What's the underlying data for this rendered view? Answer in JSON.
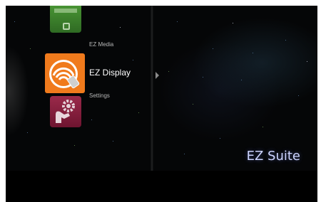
{
  "menu": {
    "items": [
      {
        "id": "ez-media",
        "label": "EZ Media",
        "icon": "ez-media-icon",
        "color": "#3d7d2e"
      },
      {
        "id": "ez-display",
        "label": "EZ Display",
        "icon": "ez-display-wifi-icon",
        "color": "#f07a1c",
        "selected": true
      },
      {
        "id": "settings",
        "label": "Settings",
        "icon": "settings-gear-arm-icon",
        "color": "#8a1f3e"
      }
    ]
  },
  "brand": {
    "title": "EZ Suite",
    "color": "#cdd4ff"
  },
  "colors": {
    "background": "#050607",
    "active_tile": "#f07a1c"
  }
}
